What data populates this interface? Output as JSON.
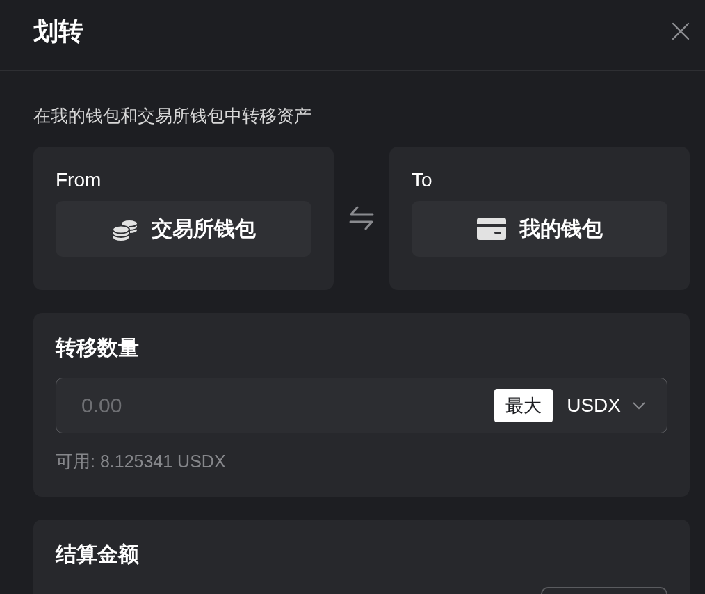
{
  "dialog": {
    "title": "划转",
    "description": "在我的钱包和交易所钱包中转移资产"
  },
  "transfer": {
    "from": {
      "label": "From",
      "wallet": "交易所钱包"
    },
    "to": {
      "label": "To",
      "wallet": "我的钱包"
    }
  },
  "amount": {
    "title": "转移数量",
    "placeholder": "0.00",
    "max_button": "最大",
    "currency": "USDX",
    "available": "可用: 8.125341 USDX"
  },
  "settlement": {
    "title": "结算金额"
  }
}
